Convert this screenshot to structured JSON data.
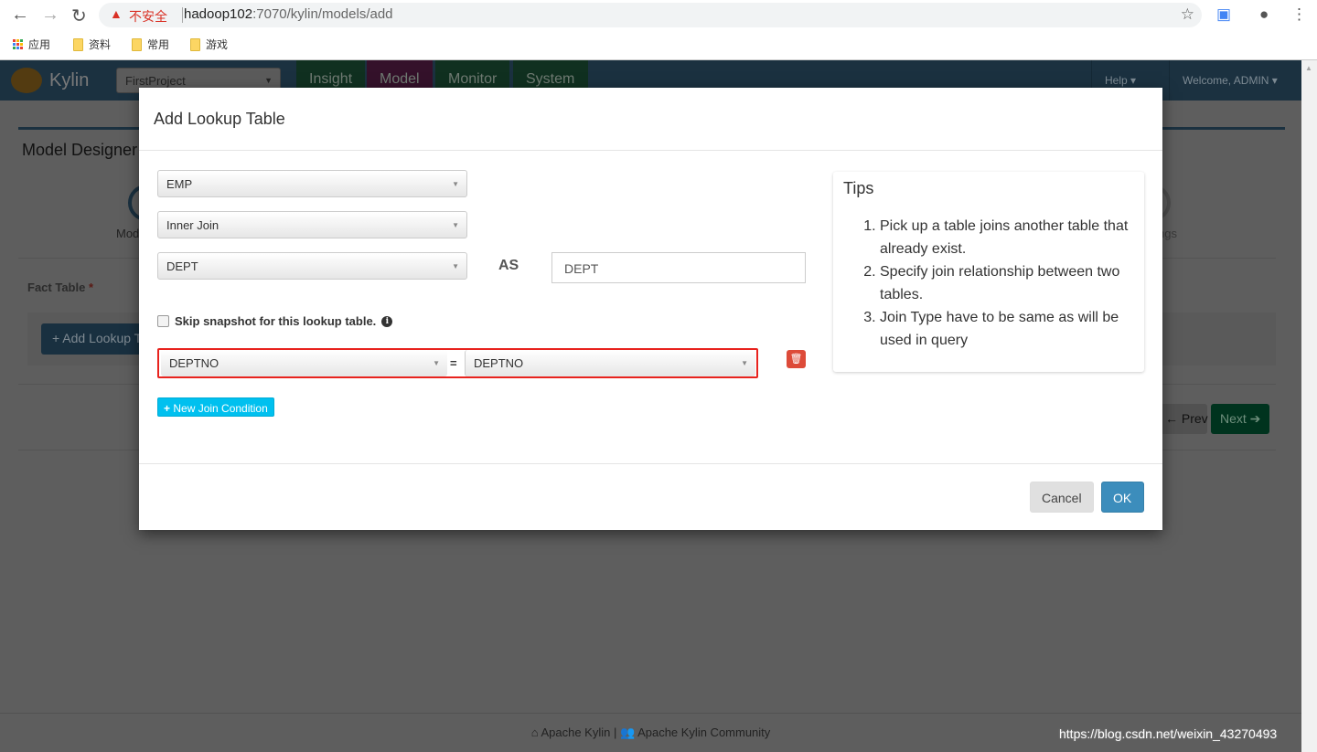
{
  "browser": {
    "insecure_label": "不安全",
    "url_host": "hadoop102",
    "url_path": ":7070/kylin/models/add",
    "bookmarks": [
      {
        "label": "应用"
      },
      {
        "label": "资料"
      },
      {
        "label": "常用"
      },
      {
        "label": "游戏"
      }
    ]
  },
  "nav": {
    "brand": "Kylin",
    "project": "FirstProject",
    "tabs": [
      {
        "label": "Insight"
      },
      {
        "label": "Model"
      },
      {
        "label": "Monitor"
      },
      {
        "label": "System"
      }
    ],
    "help": "Help",
    "welcome": "Welcome, ADMIN"
  },
  "background": {
    "title": "Model Designer",
    "step_label": "Model Info",
    "step_last": "Settings",
    "fact_table": "Fact Table",
    "required": "*",
    "add_lookup": "Add Lookup Table",
    "prev": "Prev",
    "next": "Next"
  },
  "modal": {
    "title": "Add Lookup Table",
    "fact_select": "EMP",
    "join_type": "Inner Join",
    "lookup_select": "DEPT",
    "as_label": "AS",
    "alias": "DEPT",
    "skip_snapshot": "Skip snapshot for this lookup table.",
    "join_left": "DEPTNO",
    "join_eq": "=",
    "join_right": "DEPTNO",
    "new_join": "New Join Condition",
    "tips": {
      "title": "Tips",
      "items": [
        "Pick up a table joins another table that already exist.",
        "Specify join relationship between two tables.",
        "Join Type have to be same as will be used in query"
      ]
    },
    "cancel": "Cancel",
    "ok": "OK"
  },
  "footer": {
    "left": "Apache Kylin",
    "sep": "|",
    "right": "Apache Kylin Community"
  },
  "watermark": "https://blog.csdn.net/weixin_43270493",
  "colors": {
    "primary": "#3c8dbc",
    "danger": "#dd4b39",
    "info": "#00c0ef",
    "highlight": "#e8231e"
  }
}
